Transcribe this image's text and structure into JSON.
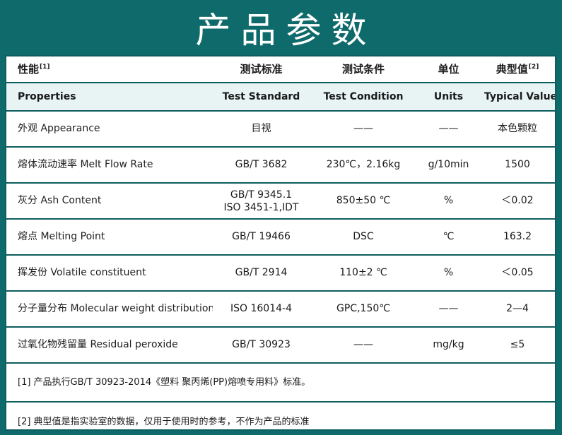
{
  "banner": {
    "title": "产品参数"
  },
  "header_cn": {
    "property": "性能",
    "property_ref": "[1]",
    "standard": "测试标准",
    "condition": "测试条件",
    "unit": "单位",
    "value": "典型值",
    "value_ref": "[2]"
  },
  "header_en": {
    "property": "Properties",
    "standard": "Test Standard",
    "condition": "Test Condition",
    "unit": "Units",
    "value": "Typical Values"
  },
  "rows": [
    {
      "property": "外观 Appearance",
      "standard": "目视",
      "standard2": "",
      "condition": "——",
      "unit": "——",
      "value": "本色颗粒"
    },
    {
      "property": "熔体流动速率 Melt Flow Rate",
      "standard": "GB/T 3682",
      "standard2": "",
      "condition": "230℃，2.16kg",
      "unit": "g/10min",
      "value": "1500"
    },
    {
      "property": "灰分 Ash Content",
      "standard": "GB/T 9345.1",
      "standard2": "ISO 3451-1,IDT",
      "condition": "850±50 ℃",
      "unit": "%",
      "value": "＜0.02"
    },
    {
      "property": "熔点 Melting Point",
      "standard": "GB/T 19466",
      "standard2": "",
      "condition": "DSC",
      "unit": "℃",
      "value": "163.2"
    },
    {
      "property": "挥发份 Volatile constituent",
      "standard": "GB/T 2914",
      "standard2": "",
      "condition": "110±2 ℃",
      "unit": "%",
      "value": "＜0.05"
    },
    {
      "property": "分子量分布 Molecular weight distribution",
      "standard": "ISO 16014-4",
      "standard2": "",
      "condition": "GPC,150℃",
      "unit": "——",
      "value": "2—4"
    },
    {
      "property": "过氧化物残留量 Residual peroxide",
      "standard": "GB/T 30923",
      "standard2": "",
      "condition": "——",
      "unit": "mg/kg",
      "value": "≤5"
    }
  ],
  "notes": [
    "[1] 产品执行GB/T 30923-2014《塑料 聚丙烯(PP)熔喷专用料》标准。",
    "[2] 典型值是指实验室的数据，仅用于使用时的参考，不作为产品的标准"
  ],
  "colors": {
    "frame": "#0f6b6b",
    "rule": "#0d5e5e",
    "header_band": "#e7f4f3"
  }
}
